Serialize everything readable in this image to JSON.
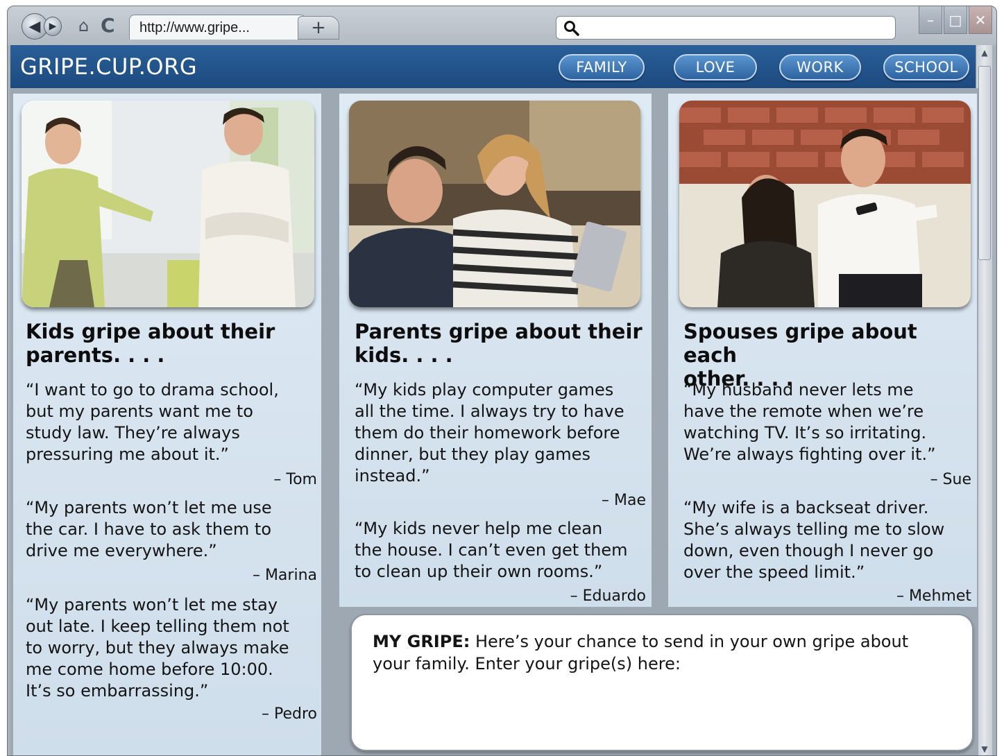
{
  "browser": {
    "tab_url": "http://www.gripe...",
    "new_tab_glyph": "+",
    "search_icon": "search-icon",
    "search_value": ""
  },
  "site": {
    "title": "GRIPE.CUP.ORG",
    "nav": [
      "FAMILY",
      "LOVE",
      "WORK",
      "SCHOOL"
    ]
  },
  "columns": [
    {
      "headline_line1": "Kids gripe about their",
      "headline_line2": "parents. . . .",
      "photo": "two teenage boys arguing in a living room",
      "quotes": [
        {
          "lines": [
            "“I want to go to drama school,",
            "but my parents want me to",
            "study law. They’re always",
            "pressuring me about it.”"
          ],
          "author": "– Tom"
        },
        {
          "lines": [
            "“My parents won’t let me use",
            "the car. I have to ask them to",
            "drive me everywhere.”"
          ],
          "author": "– Marina"
        },
        {
          "lines": [
            "“My parents won’t let me stay",
            "out late. I keep telling them not",
            "to worry, but they always make",
            "me come home before 10:00.",
            "It’s so embarrassing.”"
          ],
          "author": "– Pedro"
        }
      ]
    },
    {
      "headline_line1": "Parents gripe about their",
      "headline_line2": "kids. . . .",
      "photo": "mother scolding teenage son on a sofa",
      "quotes": [
        {
          "lines": [
            "“My kids play computer games",
            "all the time. I always try to have",
            "them do their homework before",
            "dinner, but they play games",
            "instead.”"
          ],
          "author": "– Mae"
        },
        {
          "lines": [
            "“My kids never help me clean",
            "the house. I can’t even get them",
            "to clean up their own rooms.”"
          ],
          "author": "– Eduardo"
        }
      ]
    },
    {
      "headline_line1": "Spouses gripe about each",
      "headline_line2": "other. . . .",
      "photo": "couple on a sofa, husband holding the remote",
      "quotes": [
        {
          "lines": [
            "“My husband never lets me",
            "have the remote when we’re",
            "watching TV. It’s so irritating.",
            "We’re always fighting over it.”"
          ],
          "author": "– Sue"
        },
        {
          "lines": [
            "“My wife is a backseat driver.",
            "She’s always telling me to slow",
            "down, even though I never go",
            "over the speed limit.”"
          ],
          "author": "– Mehmet"
        }
      ]
    }
  ],
  "my_gripe": {
    "label": "MY GRIPE:",
    "line1": "Here’s your chance to send in your own gripe about",
    "line2": "your family. Enter your gripe(s) here:",
    "input_value": ""
  }
}
